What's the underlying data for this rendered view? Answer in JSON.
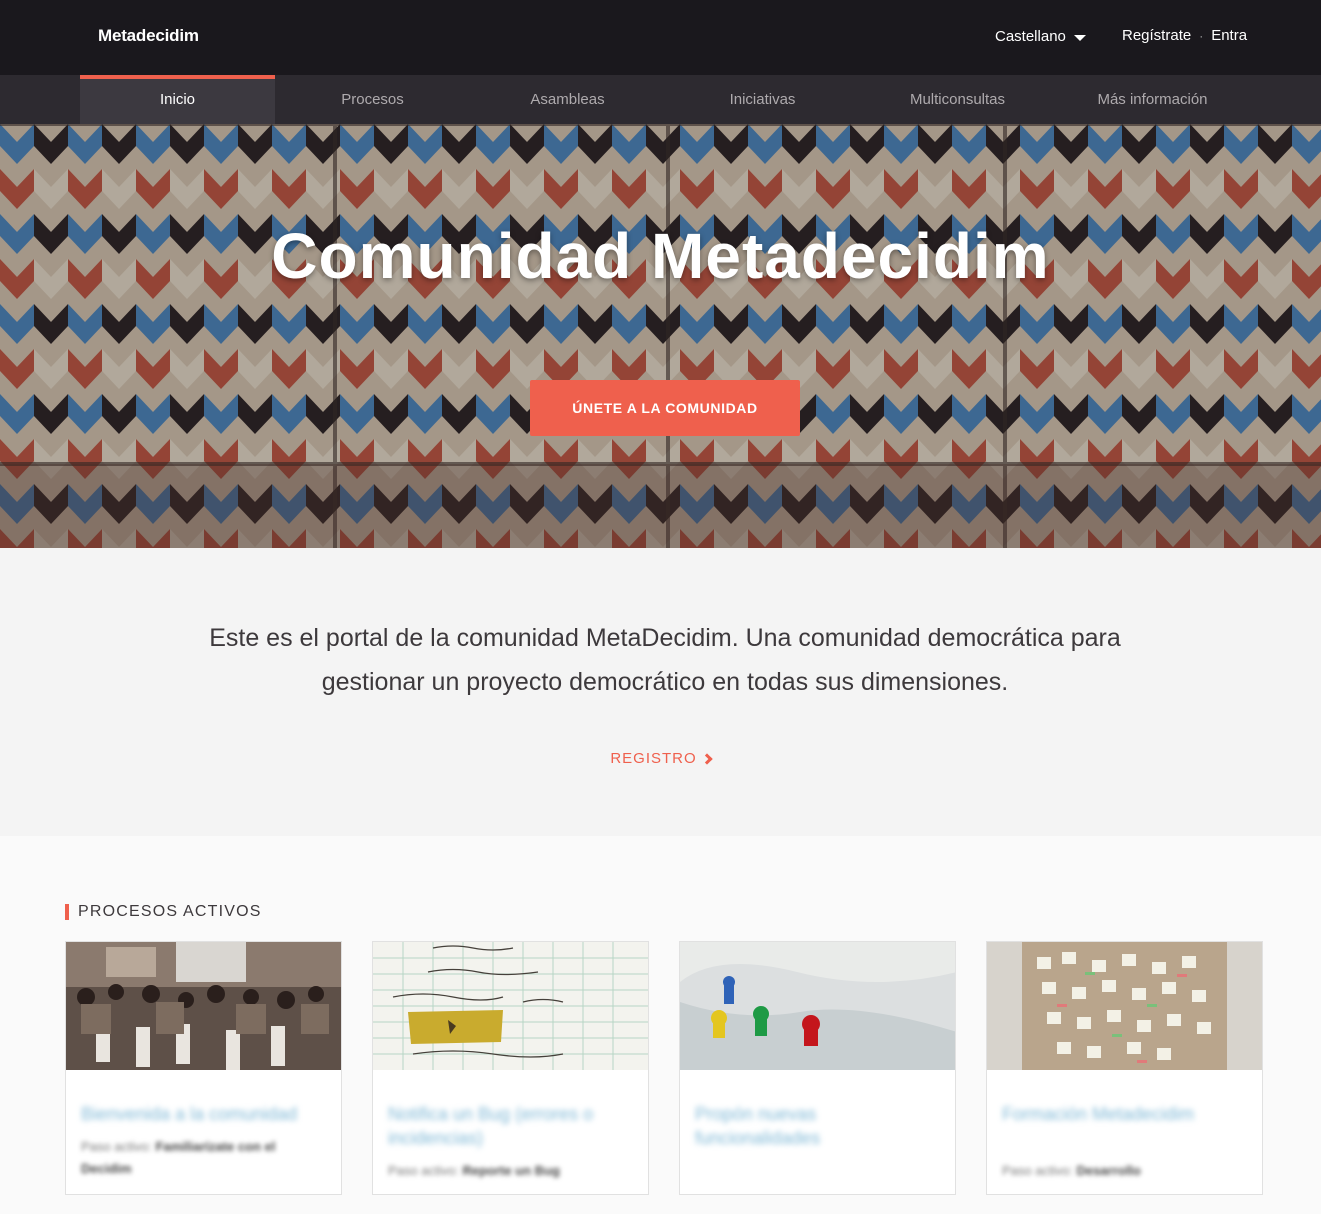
{
  "header": {
    "logo": "Metadecidim",
    "language": "Castellano",
    "register": "Regístrate",
    "separator": "·",
    "login": "Entra"
  },
  "nav": {
    "items": [
      {
        "label": "Inicio",
        "active": true
      },
      {
        "label": "Procesos",
        "active": false
      },
      {
        "label": "Asambleas",
        "active": false
      },
      {
        "label": "Iniciativas",
        "active": false
      },
      {
        "label": "Multiconsultas",
        "active": false
      },
      {
        "label": "Más información",
        "active": false
      }
    ]
  },
  "hero": {
    "title": "Comunidad Metadecidim",
    "cta": "ÚNETE A LA COMUNIDAD"
  },
  "intro": {
    "text": "Este es el portal de la comunidad MetaDecidim. Una comunidad democrática para gestionar un proyecto democrático en todas sus dimensiones.",
    "link": "REGISTRO"
  },
  "processes": {
    "title": "PROCESOS ACTIVOS",
    "cards": [
      {
        "title": "Bienvenida a la comunidad",
        "meta_prefix": "Paso activo:",
        "meta_value": "Familiarízate con el Decidim"
      },
      {
        "title": "Notifica un Bug (errores o incidencias)",
        "meta_prefix": "Paso activo:",
        "meta_value": "Reporte un Bug"
      },
      {
        "title": "Propón nuevas funcionalidades",
        "meta_prefix": "",
        "meta_value": ""
      },
      {
        "title": "Formación Metadecidim",
        "meta_prefix": "Paso activo:",
        "meta_value": "Desarrollo"
      }
    ]
  },
  "colors": {
    "accent": "#ef604d",
    "topbar": "#1a181d",
    "nav": "#2d2a30"
  }
}
